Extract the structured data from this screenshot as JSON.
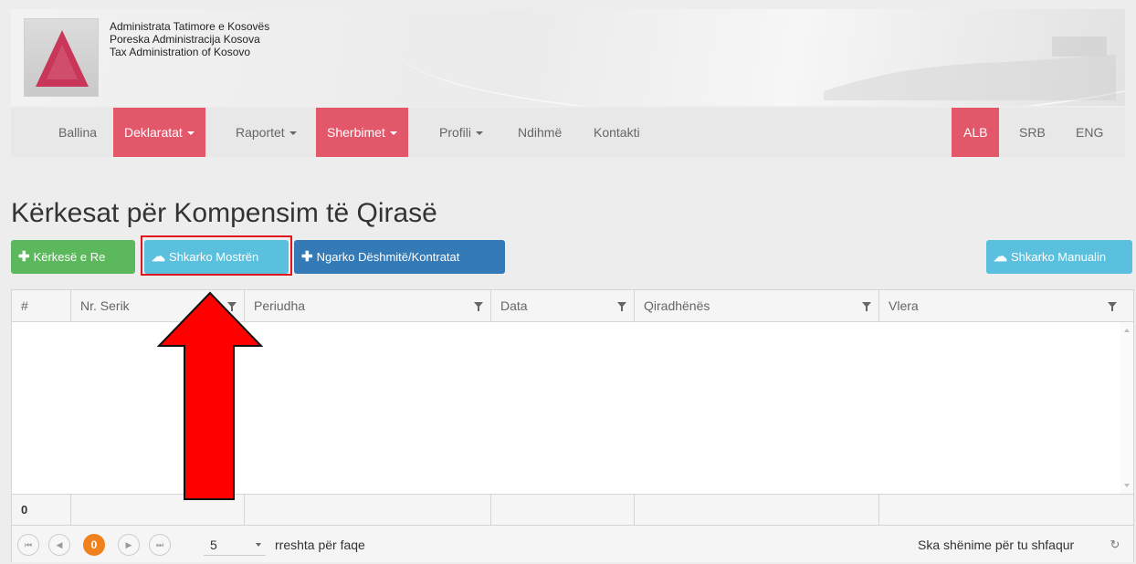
{
  "header": {
    "org_lines": [
      "Administrata Tatimore e Kosovës",
      "Poreska Administracija Kosova",
      "Tax Administration of Kosovo"
    ]
  },
  "nav": {
    "items": [
      {
        "label": "Ballina",
        "dropdown": false,
        "active": false
      },
      {
        "label": "Deklaratat",
        "dropdown": true,
        "active": true
      },
      {
        "label": "Raportet",
        "dropdown": true,
        "active": false
      },
      {
        "label": "Sherbimet",
        "dropdown": true,
        "active": true
      },
      {
        "label": "Profili",
        "dropdown": true,
        "active": false
      },
      {
        "label": "Ndihmë",
        "dropdown": false,
        "active": false
      },
      {
        "label": "Kontakti",
        "dropdown": false,
        "active": false
      }
    ],
    "languages": [
      {
        "label": "ALB",
        "active": true
      },
      {
        "label": "SRB",
        "active": false
      },
      {
        "label": "ENG",
        "active": false
      }
    ]
  },
  "page": {
    "title": "Kërkesat për Kompensim të Qirasë"
  },
  "toolbar": {
    "new_request": "Kërkesë e Re",
    "download_template": "Shkarko Mostrën",
    "upload_evidence": "Ngarko Dëshmitë/Kontratat",
    "download_manual": "Shkarko Manualin"
  },
  "grid": {
    "columns": [
      "#",
      "Nr. Serik",
      "Periudha",
      "Data",
      "Qiradhënës",
      "Vlera"
    ],
    "rows": [],
    "footer_count": "0"
  },
  "pager": {
    "current_page": "0",
    "page_size": "5",
    "page_size_label": "rreshta për faqe",
    "empty_message": "Ska shënime për tu shfaqur"
  },
  "colors": {
    "accent": "#e3576b",
    "green": "#5cb85c",
    "cyan": "#5bc0de",
    "blue": "#337ab7",
    "pager_current": "#f0811c",
    "annotation": "#e0141c"
  }
}
